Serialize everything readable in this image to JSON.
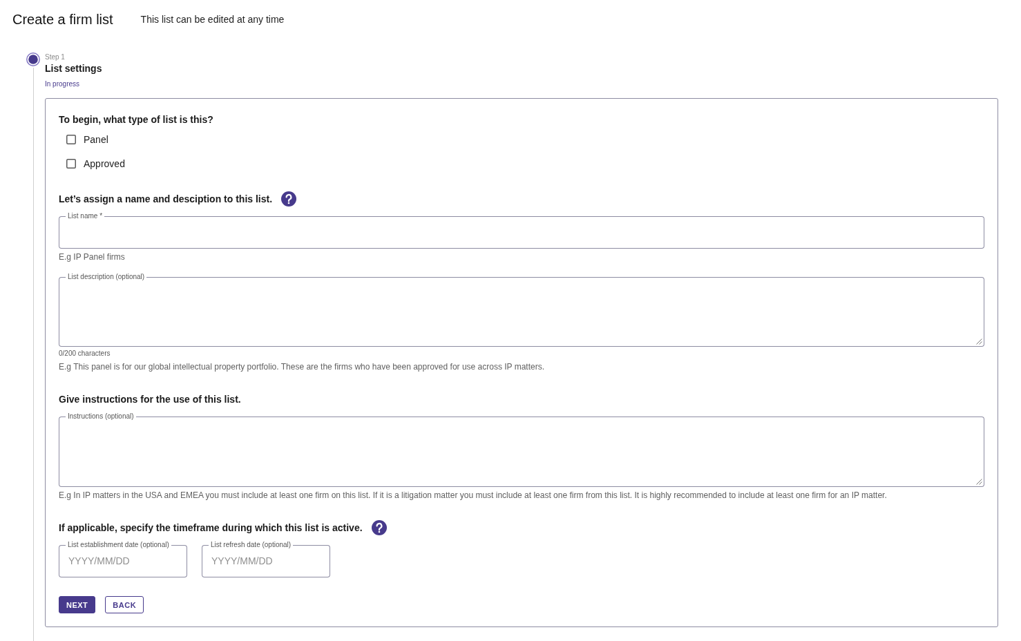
{
  "header": {
    "title": "Create a firm list",
    "subtitle": "This list can be edited at any time"
  },
  "stepper": {
    "label": "Step 1",
    "title": "List settings",
    "status": "In progress",
    "active": true
  },
  "form": {
    "sections": [
      {
        "question": "To begin, what type of list is this?",
        "help_icon": false,
        "items": [
          {
            "kind": "checkbox",
            "label": "Panel",
            "checked": false
          },
          {
            "kind": "checkbox",
            "label": "Approved",
            "checked": false
          }
        ]
      },
      {
        "question": "Let’s assign a name and desciption to this list.",
        "help_icon": true,
        "items": [
          {
            "kind": "text_field",
            "label": "List name *",
            "hint": "E.g IP Panel firms"
          },
          {
            "kind": "textarea",
            "label": "List description (optional)",
            "counter": "0/200 characters",
            "hint": "E.g This panel is for our global intellectual property portfolio. These are the firms who have been approved for use across IP matters."
          }
        ]
      },
      {
        "question": "Give instructions for the use of this list.",
        "help_icon": false,
        "items": [
          {
            "kind": "textarea",
            "label": "Instructions (optional)",
            "hint": "E.g In IP matters in the USA and EMEA you must include at least one firm on this list. If it is a litigation matter you must include at least one firm from this list. It is highly recommended to include at least one firm for an IP matter."
          }
        ]
      },
      {
        "question": "If applicable, specify the timeframe during which this list is active.",
        "help_icon": true,
        "items": [
          {
            "kind": "date_field",
            "label": "List establishment date (optional)",
            "placeholder": "YYYY/MM/DD"
          },
          {
            "kind": "date_field",
            "label": "List refresh date (optional)",
            "placeholder": "YYYY/MM/DD"
          }
        ]
      }
    ],
    "buttons": [
      {
        "label": "NEXT",
        "kind": "primary"
      },
      {
        "label": "BACK",
        "kind": "secondary"
      }
    ]
  }
}
